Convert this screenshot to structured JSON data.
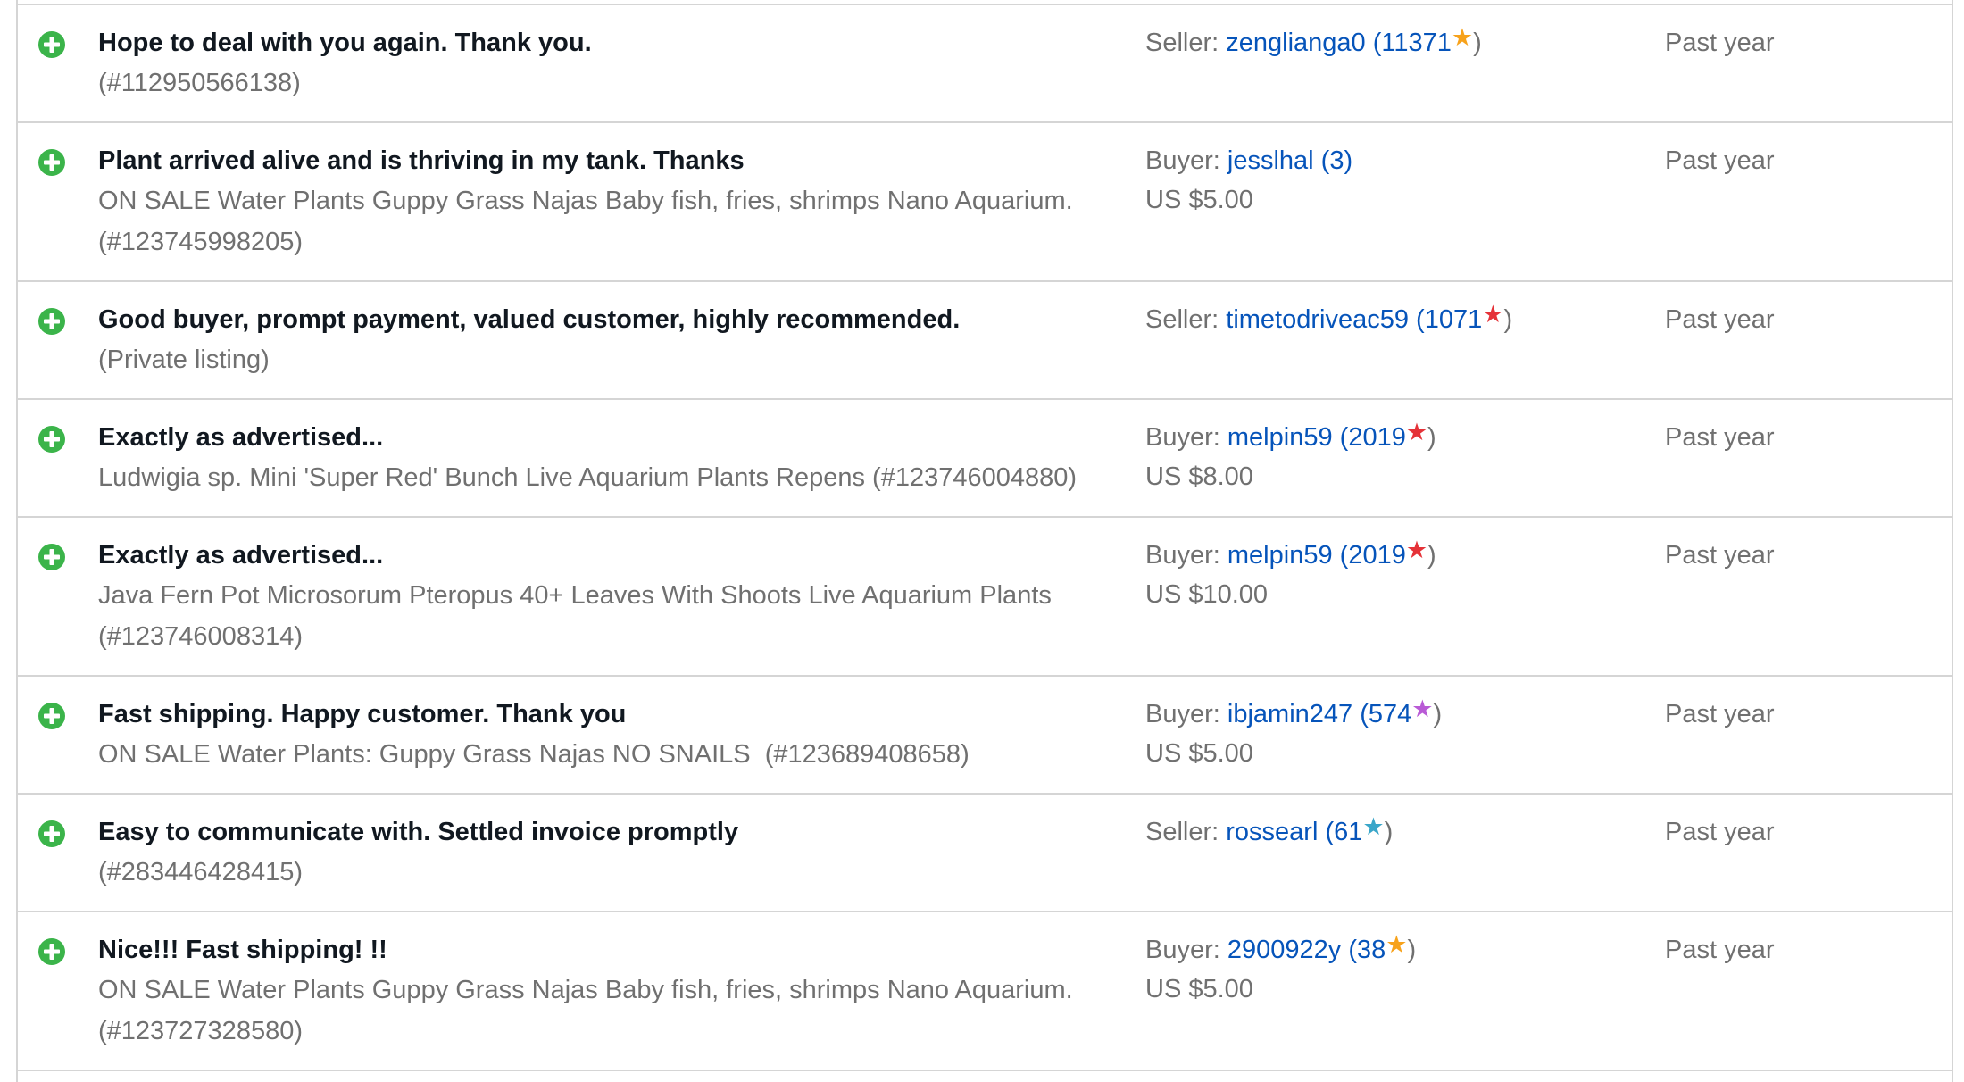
{
  "time_label": "Past year",
  "colors": {
    "positive": "#3bb44a",
    "link": "#0654ba",
    "muted": "#707070",
    "star_yellow": "#f7a21b",
    "star_red": "#e53238",
    "star_purple": "#b95ad6",
    "star_teal": "#3aa6c9"
  },
  "rows": [
    {
      "comment": "Hope to deal with you again. Thank you.",
      "item": "(#112950566138)",
      "role": "Seller:",
      "user": "zengliang",
      "user_suffix": "a0",
      "score": "11371",
      "star": "shooting-star",
      "price": "",
      "time": "Past year"
    },
    {
      "comment": "Plant arrived alive and is thriving in my tank. Thanks",
      "item": "ON SALE Water Plants Guppy Grass Najas Baby fish, fries, shrimps Nano Aquarium. (#123745998205)",
      "role": "Buyer:",
      "user": "jesslhal",
      "user_suffix": "",
      "score": "3",
      "star": "",
      "price": "US $5.00",
      "time": "Past year"
    },
    {
      "comment": "Good buyer, prompt payment, valued customer, highly recommended.",
      "item": "(Private listing)",
      "role": "Seller:",
      "user": "timetodriveac59",
      "user_suffix": "",
      "score": "1071",
      "star": "red",
      "price": "",
      "time": "Past year"
    },
    {
      "comment": "Exactly as advertised...",
      "item": "Ludwigia sp. Mini 'Super Red' Bunch Live Aquarium Plants Repens (#123746004880)",
      "role": "Buyer:",
      "user": "melpin59",
      "user_suffix": "",
      "score": "2019",
      "star": "red",
      "price": "US $8.00",
      "time": "Past year"
    },
    {
      "comment": "Exactly as advertised...",
      "item": "Java Fern Pot Microsorum Pteropus 40+ Leaves With Shoots Live Aquarium Plants (#123746008314)",
      "role": "Buyer:",
      "user": "melpin59",
      "user_suffix": "",
      "score": "2019",
      "star": "red",
      "price": "US $10.00",
      "time": "Past year"
    },
    {
      "comment": "Fast shipping. Happy customer. Thank you",
      "item": "ON SALE Water Plants: Guppy Grass Najas NO SNAILS  (#123689408658)",
      "role": "Buyer:",
      "user": "ibjamin247",
      "user_suffix": "",
      "score": "574",
      "star": "purple",
      "price": "US $5.00",
      "time": "Past year"
    },
    {
      "comment": "Easy to communicate with. Settled invoice promptly",
      "item": "(#283446428415)",
      "role": "Seller:",
      "user": "rossearl",
      "user_suffix": "",
      "score": "61",
      "star": "teal",
      "price": "",
      "time": "Past year"
    },
    {
      "comment": "Nice!!! Fast shipping! !!",
      "item": "ON SALE Water Plants Guppy Grass Najas Baby fish, fries, shrimps Nano Aquarium. (#123727328580)",
      "role": "Buyer:",
      "user": "2900922y",
      "user_suffix": "",
      "score": "38",
      "star": "yellow",
      "price": "US $5.00",
      "time": "Past year"
    }
  ]
}
